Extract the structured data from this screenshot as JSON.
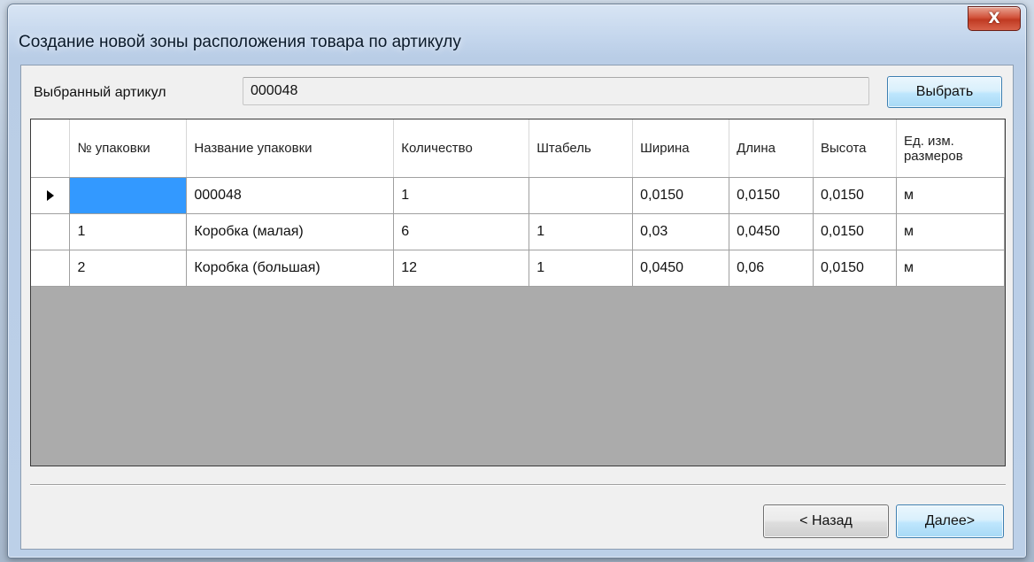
{
  "window": {
    "title": "Создание новой зоны расположения товара по артикулу",
    "close_glyph": "X"
  },
  "article": {
    "label": "Выбранный артикул",
    "value": "000048",
    "select_button": "Выбрать"
  },
  "grid": {
    "columns": [
      "№ упаковки",
      "Название упаковки",
      "Количество",
      "Штабель",
      "Ширина",
      "Длина",
      "Высота",
      "Ед. изм. размеров"
    ],
    "rows": [
      [
        "",
        "000048",
        "1",
        "",
        "0,0150",
        "0,0150",
        "0,0150",
        "м"
      ],
      [
        "1",
        "Коробка (малая)",
        "6",
        "1",
        "0,03",
        "0,0450",
        "0,0150",
        "м"
      ],
      [
        "2",
        "Коробка (большая)",
        "12",
        "1",
        "0,0450",
        "0,06",
        "0,0150",
        "м"
      ]
    ],
    "current_row": 0,
    "selected_cell_color": "#3399ff",
    "empty_area_color": "#ababab"
  },
  "footer": {
    "back_button": "< Назад",
    "next_button": "Далее>"
  },
  "colors": {
    "close_button": "#d2533b",
    "accent_button": "#bee6fd"
  }
}
